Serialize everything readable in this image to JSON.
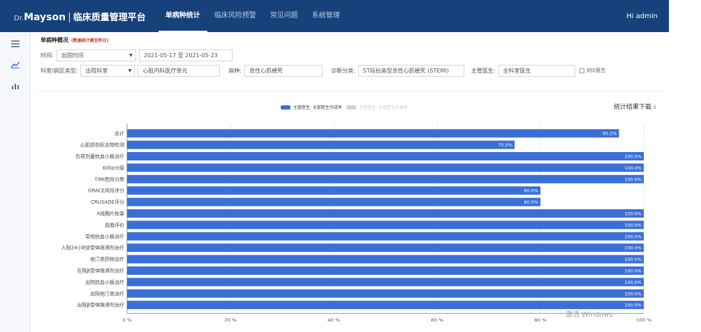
{
  "header": {
    "logo_prefix": "Dr.",
    "logo_brand": "Mayson",
    "logo_sep": "|",
    "system_title": "临床质量管理平台",
    "nav": [
      "单病种统计",
      "临床风险预警",
      "常见问题",
      "系统管理"
    ],
    "active_nav": 0,
    "greeting": "Hi admin"
  },
  "sidebar": {
    "icons": [
      "menu-icon",
      "line-chart-icon",
      "bar-chart-icon"
    ]
  },
  "page": {
    "title": "单病种概况",
    "note": "(数据统计截至昨日)"
  },
  "filters": {
    "time_label": "时间:",
    "time_type": "出院时间",
    "date_range": "2021-05-17 至 2021-05-23",
    "dept_label": "科室/病区类型:",
    "dept_type": "出院科室",
    "dept_value": "心脏内科医疗单元",
    "disease_label": "病种:",
    "disease_value": "急性心肌梗死",
    "diag_label": "诊断分类:",
    "diag_value": "ST段抬高型急性心肌梗死 (STEMI)",
    "doctor_label": "主管医生:",
    "doctor_value": "全科室医生",
    "compare_label": "对比医生"
  },
  "chart_actions": {
    "download": "统计结果下载"
  },
  "legend": {
    "series1": "主管医生: 全部医生完成率",
    "series2": "主管医生: 全部医生合格率"
  },
  "watermark": "激活 Windows",
  "colors": {
    "header": "#16417a",
    "bar": "#3b6fd8",
    "series2": "#cfd3da"
  },
  "chart_data": {
    "type": "bar",
    "orientation": "horizontal",
    "categories": [
      "总计",
      "心肌损伤标志物检测",
      "负荷剂量抗血小板治疗",
      "Killip分级",
      "TIMI危险分层",
      "GRACE风险评分",
      "CRUSADE评分",
      "X线胸片检查",
      "血脂评价",
      "常规抗血小板治疗",
      "入院24小时β受体阻滞剂治疗",
      "他汀类药物治疗",
      "在院β受体阻滞剂治疗",
      "出院抗血小板治疗",
      "出院他汀类治疗",
      "出院β受体阻滞剂治疗"
    ],
    "series": [
      {
        "name": "主管医生: 全部医生完成率",
        "values": [
          95.2,
          75.0,
          100.0,
          100.0,
          100.0,
          80.0,
          80.0,
          100.0,
          100.0,
          100.0,
          100.0,
          100.0,
          100.0,
          100.0,
          100.0,
          100.0
        ],
        "labels": [
          "95.2%",
          "75.0%",
          "100.0%",
          "100.0%",
          "100.0%",
          "80.0%",
          "80.0%",
          "100.0%",
          "100.0%",
          "100.0%",
          "100.0%",
          "100.0%",
          "100.0%",
          "100.0%",
          "100.0%",
          "100.0%"
        ]
      }
    ],
    "xticks": [
      "0 %",
      "20 %",
      "40 %",
      "60 %",
      "80 %",
      "100 %"
    ],
    "xlim": [
      0,
      100
    ],
    "grid": "vertical"
  }
}
